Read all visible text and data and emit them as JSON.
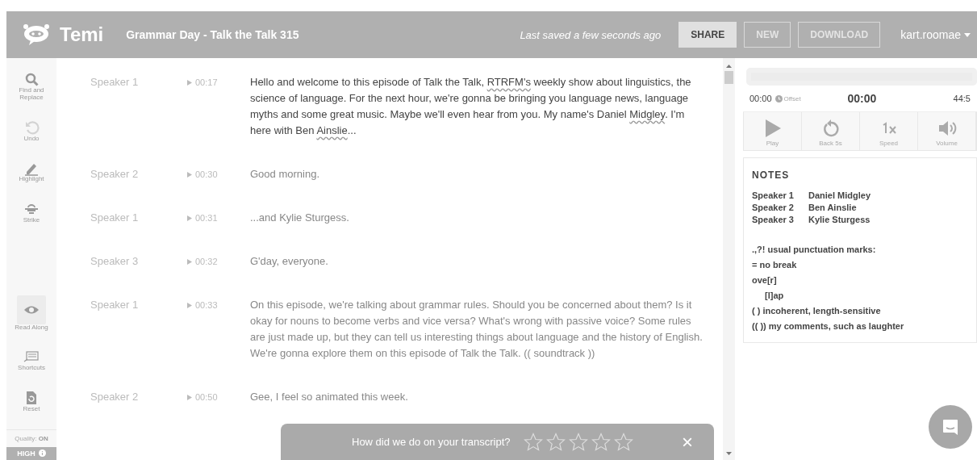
{
  "header": {
    "brand": "Temi",
    "title": "Grammar Day - Talk the Talk 315",
    "save_status": "Last saved a few seconds ago",
    "buttons": [
      {
        "label": "SHARE",
        "primary": true
      },
      {
        "label": "NEW",
        "primary": false
      },
      {
        "label": "DOWNLOAD",
        "primary": false
      }
    ],
    "user": "kart.roomae"
  },
  "tools": [
    {
      "label": "Find and Replace",
      "disabled": false,
      "selected": false
    },
    {
      "label": "Undo",
      "disabled": true,
      "selected": false
    },
    {
      "label": "Highlight",
      "disabled": false,
      "selected": false
    },
    {
      "label": "Strike",
      "disabled": false,
      "selected": false
    },
    {
      "label": "Read Along",
      "disabled": false,
      "selected": true
    },
    {
      "label": "Shortcuts",
      "disabled": false,
      "selected": false
    },
    {
      "label": "Reset",
      "disabled": false,
      "selected": false
    }
  ],
  "quality": {
    "label": "Quality: **ON**",
    "level": "HIGH"
  },
  "transcript": [
    {
      "speaker": "Speaker 1",
      "time": "00:17",
      "current": true,
      "parts": [
        {
          "text": "Hello and welcome to this episode of Talk the Talk, ",
          "misspelled": false
        },
        {
          "text": "RTRFM's",
          "misspelled": true
        },
        {
          "text": " weekly show about linguistics, the science of language. For the next hour, we're gonna be bringing you language news, language myths and some great music. Maybe we'll even hear from you. My name's Daniel ",
          "misspelled": false
        },
        {
          "text": "Midgley",
          "misspelled": true
        },
        {
          "text": ". I'm here with Ben ",
          "misspelled": false
        },
        {
          "text": "Ainslie",
          "misspelled": true
        },
        {
          "text": "...",
          "misspelled": false
        }
      ]
    },
    {
      "speaker": "Speaker 2",
      "time": "00:30",
      "current": false,
      "parts": [
        {
          "text": "Good morning.",
          "misspelled": false
        }
      ]
    },
    {
      "speaker": "Speaker 1",
      "time": "00:31",
      "current": false,
      "parts": [
        {
          "text": "...and Kylie Sturgess.",
          "misspelled": false
        }
      ]
    },
    {
      "speaker": "Speaker 3",
      "time": "00:32",
      "current": false,
      "parts": [
        {
          "text": "G'day, everyone.",
          "misspelled": false
        }
      ]
    },
    {
      "speaker": "Speaker 1",
      "time": "00:33",
      "current": false,
      "parts": [
        {
          "text": "On this episode, we're talking about grammar rules. Should you be concerned about them? Is it okay for nouns to become verbs and vice versa? What's wrong with passive voice? Some rules are just made up, but they can tell us interesting things about language and the history of English. We're gonna explore them on this episode of Talk the Talk. (( soundtrack ))",
          "misspelled": false
        }
      ]
    },
    {
      "speaker": "Speaker 2",
      "time": "00:50",
      "current": false,
      "parts": [
        {
          "text": "Gee, I feel so animated this week.",
          "misspelled": false
        }
      ]
    }
  ],
  "player": {
    "level": 0,
    "offset_time": "00:00",
    "offset_label": "Offset",
    "current_time": "00:00",
    "duration": "44:5",
    "controls": [
      {
        "label": "Play"
      },
      {
        "label": "Back 5s"
      },
      {
        "label": "Speed"
      },
      {
        "label": "Volume"
      }
    ]
  },
  "notes": {
    "title": "NOTES",
    "speakers": [
      {
        "speaker": "Speaker 1",
        "name": "Daniel Midgley"
      },
      {
        "speaker": "Speaker 2",
        "name": "Ben Ainslie"
      },
      {
        "speaker": "Speaker 3",
        "name": "Kylie Sturgess"
      }
    ],
    "legend": [
      {
        "text": ".,?! usual punctuation marks:",
        "kind": "line"
      },
      {
        "text": "= no break",
        "kind": "line"
      },
      {
        "text": "ove[r]",
        "kind": "line"
      },
      {
        "text": "[l]ap",
        "kind": "continuation"
      },
      {
        "text": "( ) incoherent, length-sensitive",
        "kind": "line"
      },
      {
        "text": "(( )) my comments, such as laughter",
        "kind": "line"
      }
    ]
  },
  "rating": {
    "question": "How did we do on your transcript?",
    "stars": 0,
    "close": "×"
  }
}
